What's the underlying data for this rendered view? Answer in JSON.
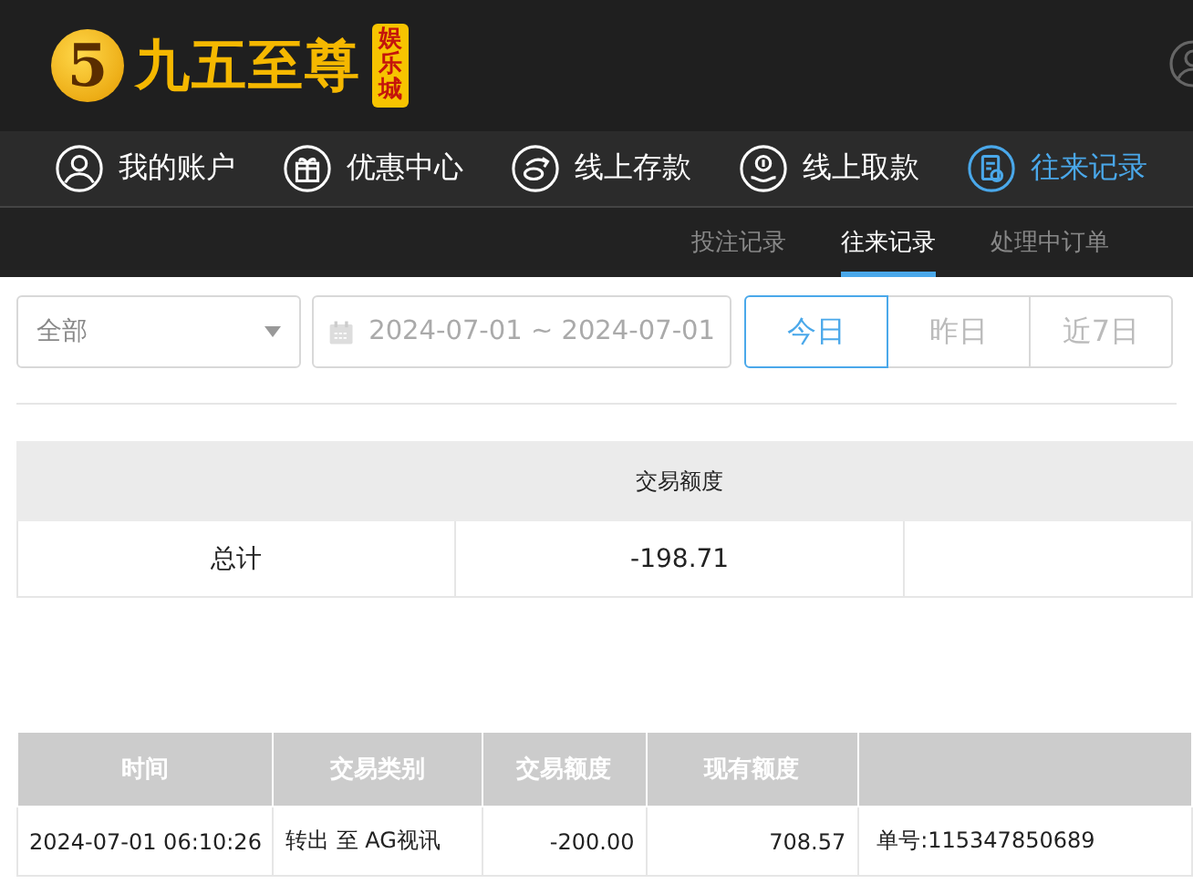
{
  "header": {
    "logo_mark": "5",
    "logo_text": "九五至尊",
    "logo_badge": "娱乐城"
  },
  "nav": [
    {
      "label": "我的账户",
      "kind": "user",
      "selected": false
    },
    {
      "label": "优惠中心",
      "kind": "gift",
      "selected": false
    },
    {
      "label": "线上存款",
      "kind": "deposit",
      "selected": false
    },
    {
      "label": "线上取款",
      "kind": "withdraw",
      "selected": false
    },
    {
      "label": "往来记录",
      "kind": "records",
      "selected": true
    }
  ],
  "subtabs": [
    {
      "label": "投注记录",
      "selected": false
    },
    {
      "label": "往来记录",
      "selected": true
    },
    {
      "label": "处理中订单",
      "selected": false
    }
  ],
  "filter": {
    "type_value": "全部",
    "date_range": "2024-07-01 ~ 2024-07-01",
    "quick": [
      {
        "label": "今日",
        "selected": true
      },
      {
        "label": "昨日",
        "selected": false
      },
      {
        "label": "近7日",
        "selected": false
      }
    ]
  },
  "summary": {
    "columns": [
      "交易额度"
    ],
    "row": [
      "总计",
      "-198.71"
    ]
  },
  "records": {
    "columns": [
      "时间",
      "交易类别",
      "交易额度",
      "现有额度"
    ],
    "rows": [
      [
        "2024-07-01 06:10:26",
        "转出 至 AG视讯",
        "-200.00",
        "708.57",
        "单号:115347850689"
      ]
    ]
  }
}
